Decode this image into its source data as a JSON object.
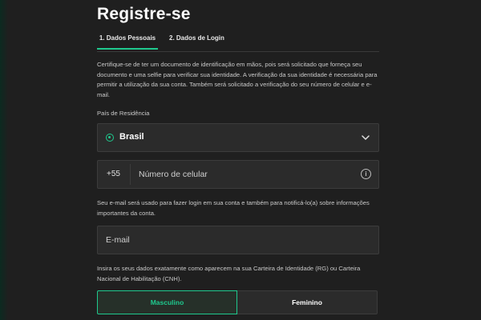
{
  "header": {
    "title": "Registre-se"
  },
  "tabs": [
    {
      "label": "1. Dados Pessoais",
      "active": true
    },
    {
      "label": "2. Dados de Login",
      "active": false
    }
  ],
  "intro_text": "Certifique-se de ter um documento de identificação em mãos, pois será solicitado que forneça seu documento e uma selfie para verificar sua identidade. A verificação da sua identidade é necessária para permitir a utilização da sua conta. Também será solicitado a verificação do seu número de celular e e-mail.",
  "country": {
    "label": "País de Residência",
    "value": "Brasil",
    "icon": "brazil-flag-icon",
    "chevron_icon": "chevron-down-icon"
  },
  "phone": {
    "prefix": "+55",
    "placeholder": "Número de celular",
    "info_icon": "info-icon",
    "info_glyph": "i"
  },
  "email_note": "Seu e-mail será usado para fazer login em sua conta e também para notificá-lo(a) sobre informações importantes da conta.",
  "email": {
    "placeholder": "E-mail"
  },
  "id_note": "Insira os seus dados exatamente como aparecem na sua Carteira de Identidade (RG) ou Carteira Nacional de Habilitação (CNH).",
  "gender": {
    "options": [
      {
        "label": "Masculino",
        "selected": true
      },
      {
        "label": "Feminino",
        "selected": false
      }
    ]
  },
  "colors": {
    "accent": "#1fc98e",
    "background": "#1f1f1f",
    "field_background": "#2b2b2b",
    "text_muted": "#c9c9c9"
  }
}
